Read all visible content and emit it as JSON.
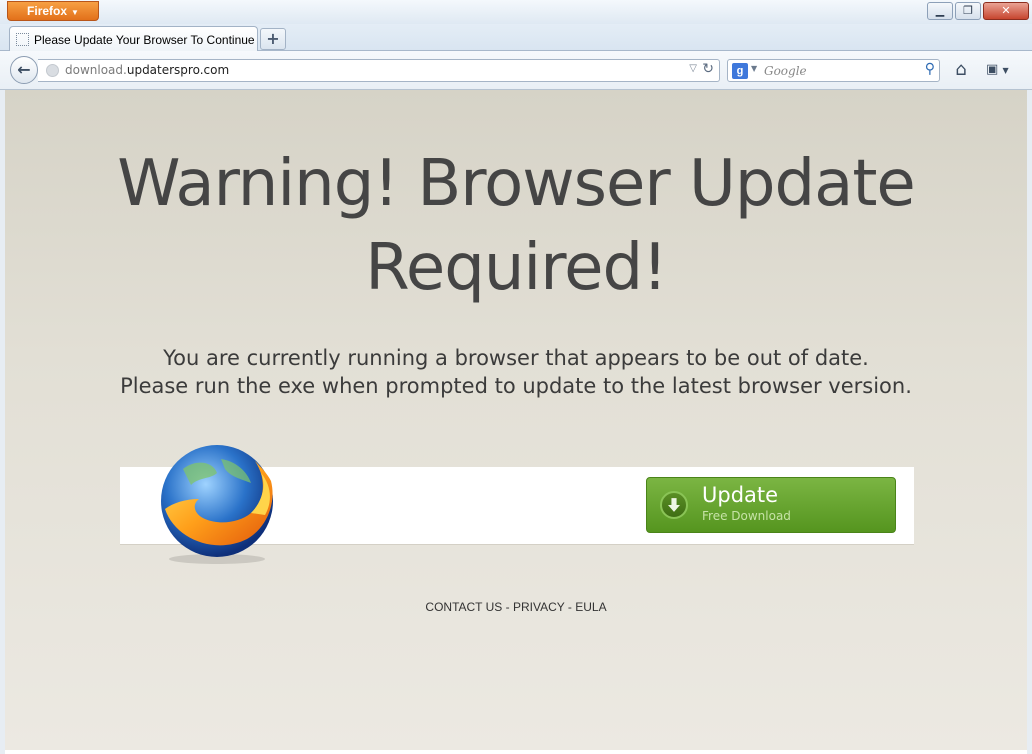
{
  "window": {
    "app_menu_label": "Firefox",
    "minimize_icon": "minimize-icon",
    "maximize_icon": "restore-icon",
    "close_icon": "close-icon"
  },
  "tabs": [
    {
      "title": "Please Update Your Browser To Continue"
    }
  ],
  "navbar": {
    "url_prefix": "download.",
    "url_host": "updaterspro.com",
    "search_engine": "g",
    "search_placeholder": "Google"
  },
  "page": {
    "headline_line1": "Warning! Browser Update",
    "headline_line2": "Required!",
    "sub_line1": "You are currently running a browser that appears to be out of date.",
    "sub_line2": "Please run the exe when prompted to update to the latest browser version.",
    "update_button": {
      "label": "Update",
      "sublabel": "Free Download"
    },
    "footer_links": [
      "CONTACT US",
      "PRIVACY",
      "EULA"
    ],
    "footer_separator": " - "
  },
  "colors": {
    "update_green": "#66a52f",
    "firefox_orange": "#e2701a",
    "headline_gray": "#454545"
  }
}
